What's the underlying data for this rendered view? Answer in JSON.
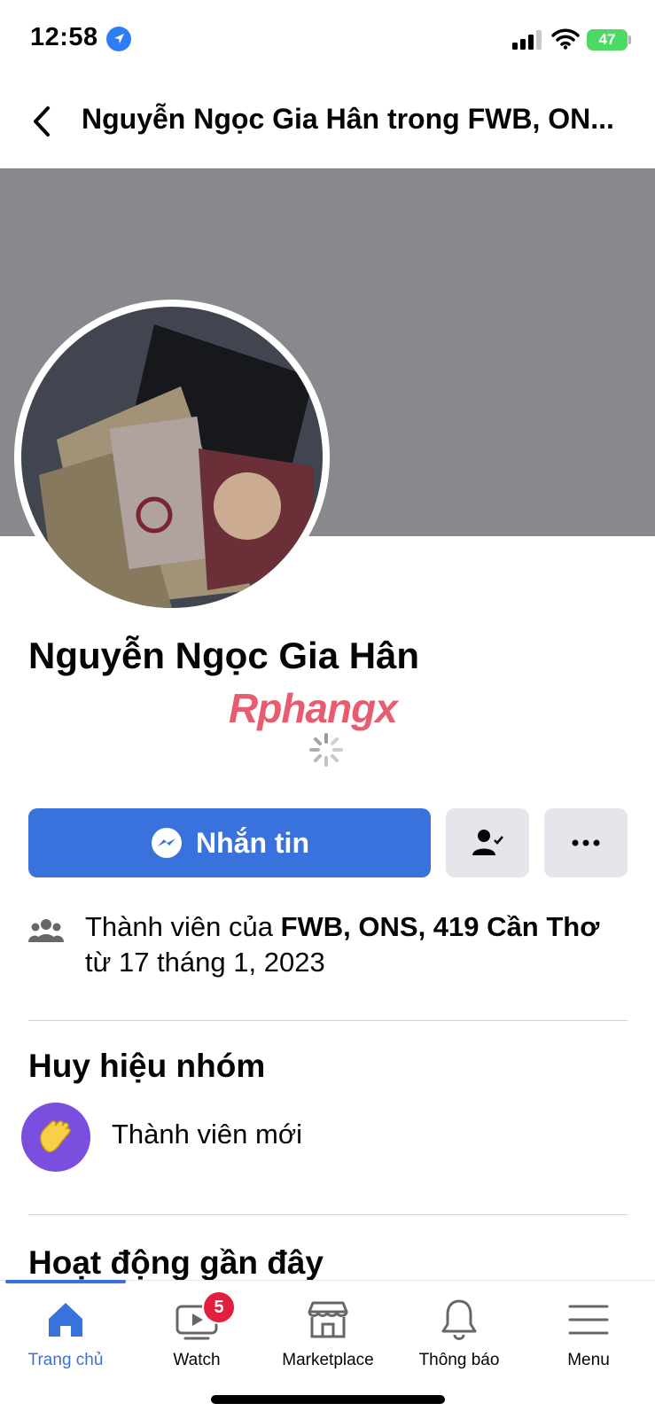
{
  "status_bar": {
    "time": "12:58",
    "battery": "47"
  },
  "header": {
    "title": "Nguyễn Ngọc Gia Hân trong FWB, ON..."
  },
  "profile": {
    "name": "Nguyễn Ngọc Gia Hân",
    "watermark": "Rphangx"
  },
  "actions": {
    "message_label": "Nhắn tin"
  },
  "membership": {
    "prefix": "Thành viên của ",
    "group": "FWB, ONS, 419 Cần Thơ",
    "since": "từ 17 tháng 1, 2023"
  },
  "badges": {
    "heading": "Huy hiệu nhóm",
    "items": [
      {
        "label": "Thành viên mới",
        "icon": "waving-hand-icon"
      }
    ]
  },
  "recent_activity": {
    "heading": "Hoạt động gần đây"
  },
  "tabbar": {
    "tabs": [
      {
        "label": "Trang chủ",
        "icon": "home-icon",
        "active": true
      },
      {
        "label": "Watch",
        "icon": "watch-icon",
        "badge": "5"
      },
      {
        "label": "Marketplace",
        "icon": "marketplace-icon"
      },
      {
        "label": "Thông báo",
        "icon": "bell-icon"
      },
      {
        "label": "Menu",
        "icon": "menu-icon"
      }
    ]
  },
  "colors": {
    "primary": "#3a72dd",
    "cover": "#88898d",
    "badge_bg": "#7a4fe0",
    "notif": "#e41e3f"
  }
}
